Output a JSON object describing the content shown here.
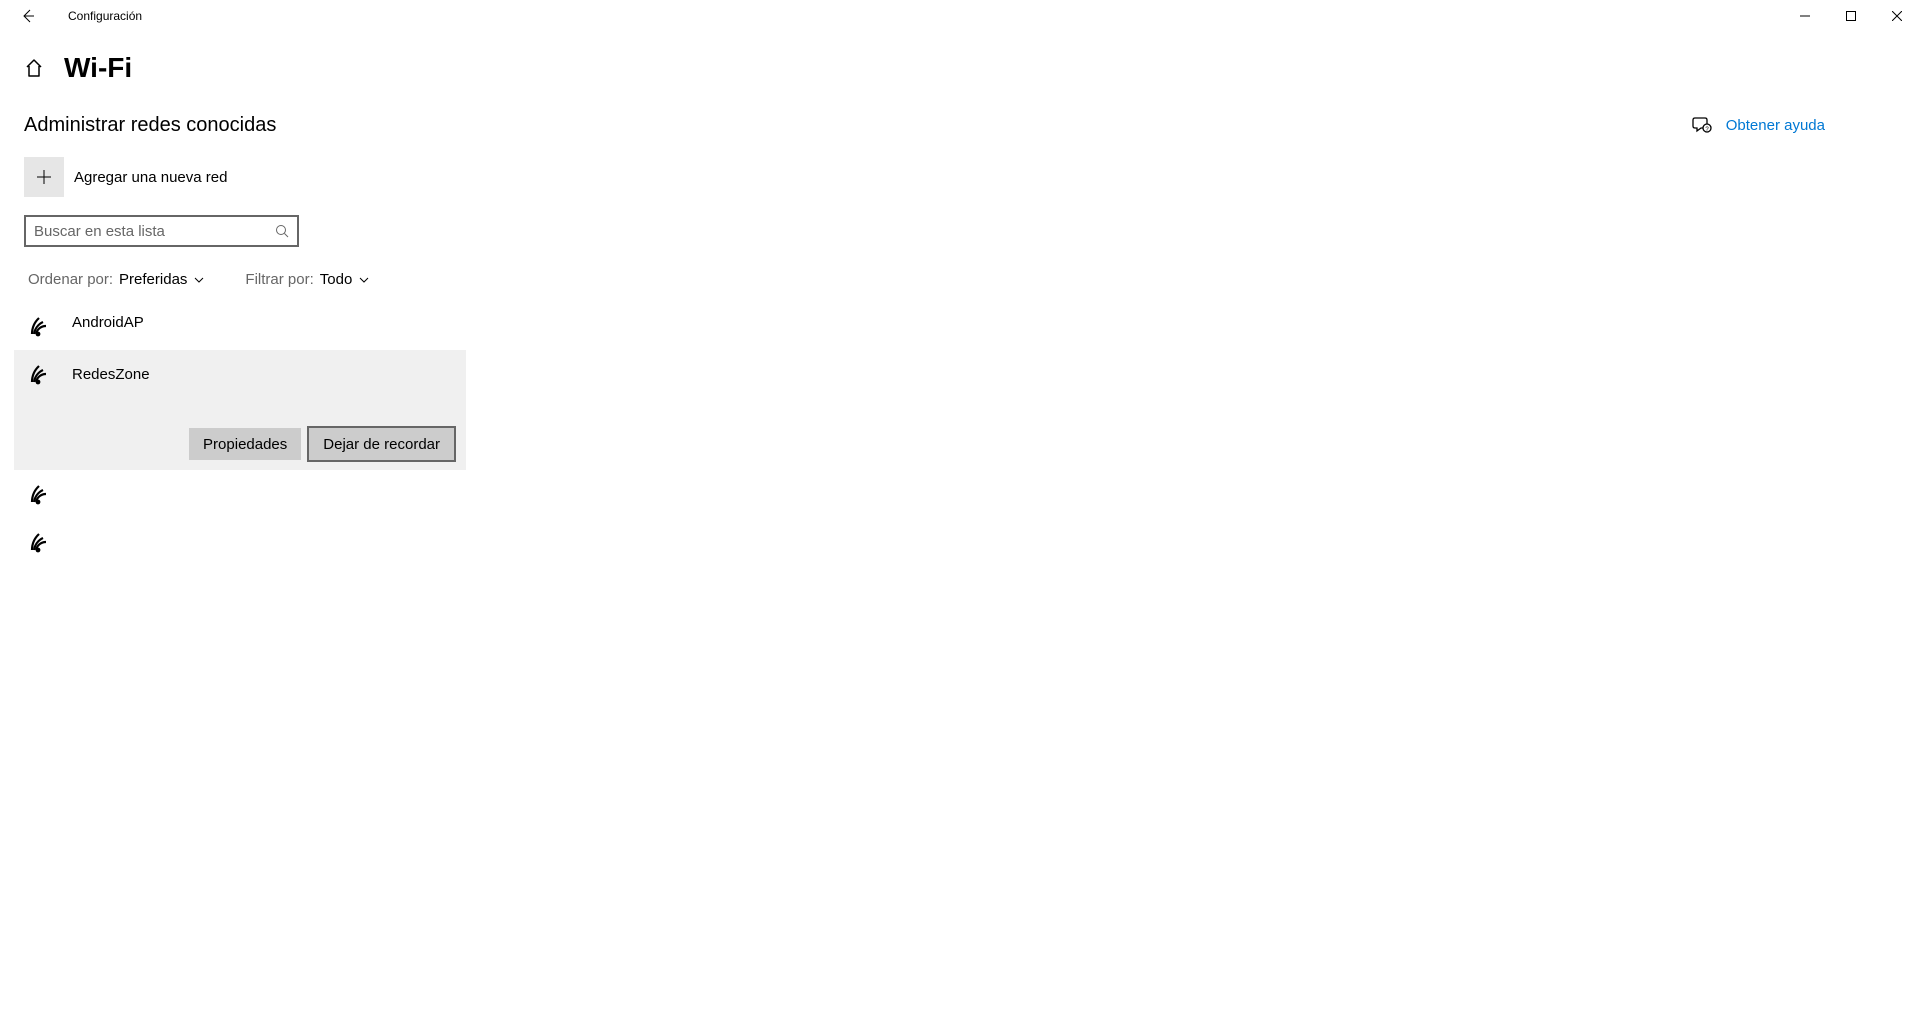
{
  "window": {
    "app_title": "Configuración"
  },
  "page": {
    "title": "Wi-Fi",
    "subheading": "Administrar redes conocidas",
    "add_label": "Agregar una nueva red",
    "search_placeholder": "Buscar en esta lista"
  },
  "filters": {
    "sort_label": "Ordenar por:",
    "sort_value": "Preferidas",
    "filter_label": "Filtrar por:",
    "filter_value": "Todo"
  },
  "networks": [
    {
      "name": "AndroidAP",
      "selected": false
    },
    {
      "name": "RedesZone",
      "selected": true
    },
    {
      "name": "",
      "selected": false
    },
    {
      "name": "",
      "selected": false
    }
  ],
  "actions": {
    "properties": "Propiedades",
    "forget": "Dejar de recordar"
  },
  "help": {
    "label": "Obtener ayuda"
  }
}
